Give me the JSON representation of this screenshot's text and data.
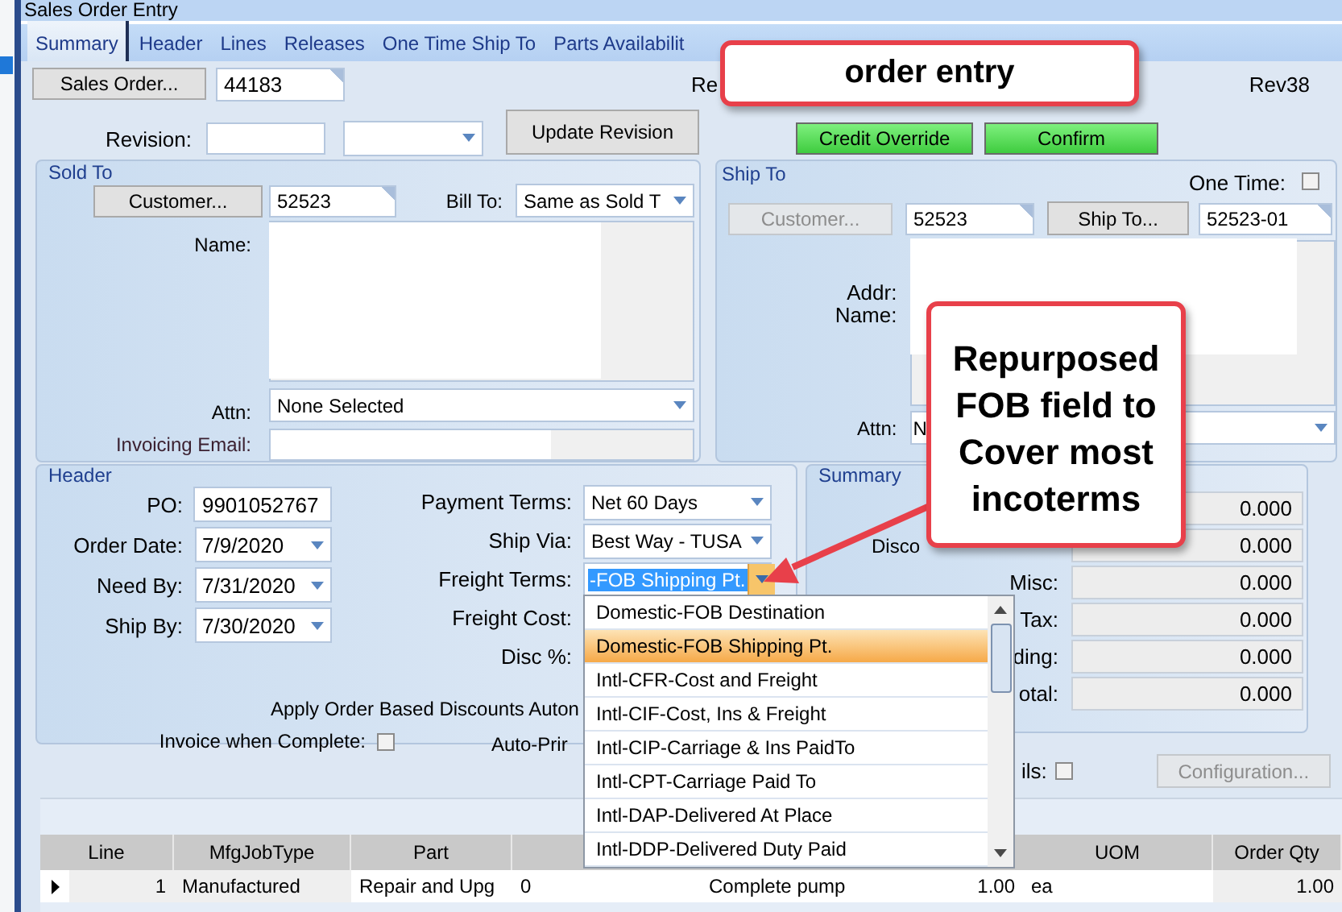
{
  "window": {
    "title": "Sales Order Entry"
  },
  "tabs": [
    {
      "label": "Summary",
      "selected": true
    },
    {
      "label": "Header",
      "selected": false
    },
    {
      "label": "Lines",
      "selected": false
    },
    {
      "label": "Releases",
      "selected": false
    },
    {
      "label": "One Time Ship To",
      "selected": false
    },
    {
      "label": "Parts Availabilit",
      "selected": false
    }
  ],
  "top": {
    "sales_order_button": "Sales Order...",
    "sales_order": "44183",
    "status": "Re",
    "revision_tag": "Rev38",
    "revision_label": "Revision:",
    "update_revision_button": "Update Revision",
    "buttons": [
      "Credit Override",
      "Confirm"
    ]
  },
  "sold_to": {
    "title": "Sold To",
    "customer_button": "Customer...",
    "customer": "52523",
    "bill_to_label": "Bill To:",
    "bill_to": "Same as Sold T",
    "name_label": "Name:",
    "attn_label": "Attn:",
    "attn": "None Selected",
    "email_label": "Invoicing Email:"
  },
  "ship_to": {
    "title": "Ship To",
    "one_time_label": "One Time:",
    "one_time": false,
    "customer_button": "Customer...",
    "customer_button_disabled": true,
    "customer": "52523",
    "ship_to_button": "Ship To...",
    "ship_to": "52523-01",
    "addr_label": "Addr:",
    "name_label": "Name:",
    "attn_label": "Attn:",
    "attn": "N"
  },
  "header": {
    "title": "Header",
    "left_fields": [
      {
        "label": "PO:",
        "value": "9901052767",
        "kind": "text"
      },
      {
        "label": "Order Date:",
        "value": "7/9/2020",
        "kind": "combo"
      },
      {
        "label": "Need By:",
        "value": "7/31/2020",
        "kind": "combo"
      },
      {
        "label": "Ship By:",
        "value": "7/30/2020",
        "kind": "combo"
      }
    ],
    "right_fields": [
      {
        "label": "Payment Terms:",
        "value": "Net 60 Days",
        "kind": "combo"
      },
      {
        "label": "Ship Via:",
        "value": "Best Way - TUSA",
        "kind": "combo"
      },
      {
        "label": "Freight Terms:",
        "value": "-FOB Shipping Pt.",
        "kind": "active"
      },
      {
        "label": "Freight Cost:",
        "kind": "label"
      },
      {
        "label": "Disc %:",
        "kind": "label"
      }
    ],
    "apply_discounts": "Apply Order Based Discounts Auton",
    "invoice_when_complete_label": "Invoice when Complete:",
    "invoice_when_complete": false,
    "auto_print": "Auto-Prir"
  },
  "summary": {
    "title": "Summary",
    "rows": [
      {
        "value": "0.000"
      },
      {
        "label": "Disco",
        "kind": "left",
        "value": "0.000"
      },
      {
        "label": "Misc:",
        "kind": "right",
        "value": "0.000"
      },
      {
        "label": "Tax:",
        "kind": "right",
        "value": "0.000"
      },
      {
        "label": "ding:",
        "kind": "right",
        "value": "0.000"
      },
      {
        "label": "otal:",
        "kind": "right",
        "value": "0.000"
      }
    ]
  },
  "details_label": "ils:",
  "details": false,
  "configuration_button": "Configuration...",
  "configuration_disabled": true,
  "table": {
    "columns": [
      "Line",
      "MfgJobType",
      "Part",
      "",
      "",
      "",
      "UOM",
      "Order Qty"
    ],
    "rows": [
      {
        "current": true,
        "cells": [
          "1",
          "Manufactured",
          "Repair and Upg",
          "0",
          "Complete pump",
          "1.00",
          "ea",
          "1.00"
        ]
      }
    ]
  },
  "dropdown": {
    "items": [
      {
        "label": "Domestic-FOB Destination",
        "selected": false
      },
      {
        "label": "Domestic-FOB Shipping Pt.",
        "selected": true
      },
      {
        "label": "Intl-CFR-Cost and Freight",
        "selected": false
      },
      {
        "label": "Intl-CIF-Cost, Ins & Freight",
        "selected": false
      },
      {
        "label": "Intl-CIP-Carriage & Ins PaidTo",
        "selected": false
      },
      {
        "label": "Intl-CPT-Carriage Paid To",
        "selected": false
      },
      {
        "label": "Intl-DAP-Delivered At Place",
        "selected": false
      },
      {
        "label": "Intl-DDP-Delivered Duty Paid",
        "selected": false
      }
    ]
  },
  "annotations": [
    {
      "text": "order entry"
    },
    {
      "text": "Repurposed FOB field to Cover most incoterms"
    }
  ]
}
